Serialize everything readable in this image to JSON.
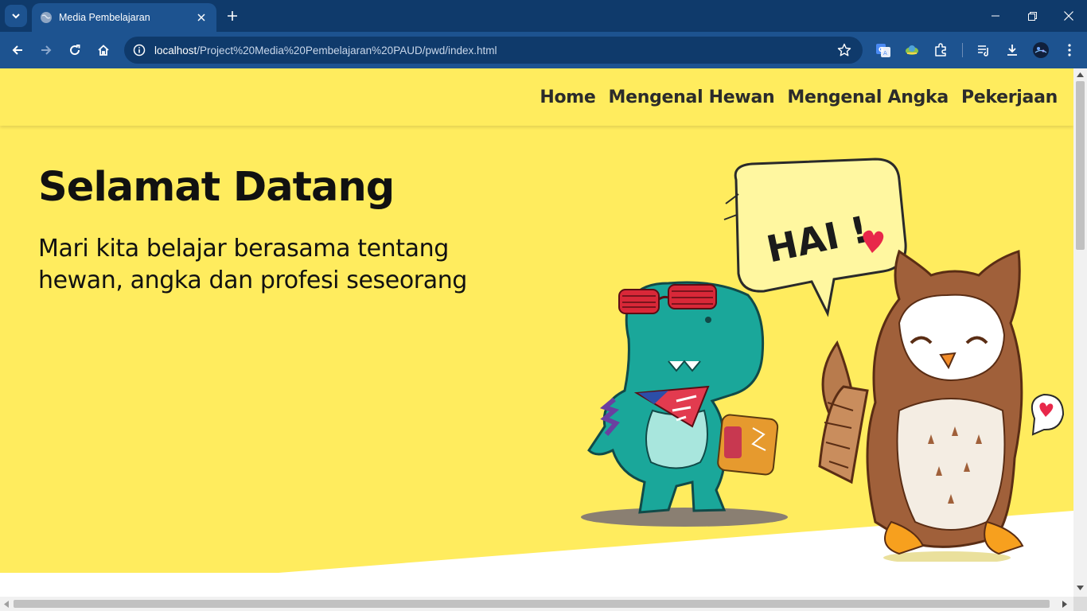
{
  "browser": {
    "tab_title": "Media Pembelajaran",
    "url_host": "localhost",
    "url_path": "/Project%20Media%20Pembelajaran%20PAUD/pwd/index.html"
  },
  "nav": {
    "items": [
      "Home",
      "Mengenal Hewan",
      "Mengenal Angka",
      "Pekerjaan"
    ]
  },
  "hero": {
    "title": "Selamat Datang",
    "subtitle_line1": "Mari kita belajar berasama tentang",
    "subtitle_line2": "hewan, angka dan profesi seseorang",
    "bubble_text": "HAI !"
  },
  "colors": {
    "hero_bg": "#ffec5e",
    "chrome_dark": "#0f3a6b",
    "chrome_mid": "#1d5390",
    "dino": "#1aa79a",
    "owl": "#a0603a"
  },
  "icons": [
    "tab-search-icon",
    "globe-icon",
    "close-icon",
    "plus-icon",
    "minimize-icon",
    "restore-icon",
    "window-close-icon",
    "back-icon",
    "forward-icon",
    "reload-icon",
    "home-icon",
    "info-icon",
    "star-icon",
    "translate-icon",
    "extension-icon",
    "puzzle-icon",
    "reading-list-icon",
    "download-icon",
    "profile-icon",
    "menu-icon"
  ]
}
